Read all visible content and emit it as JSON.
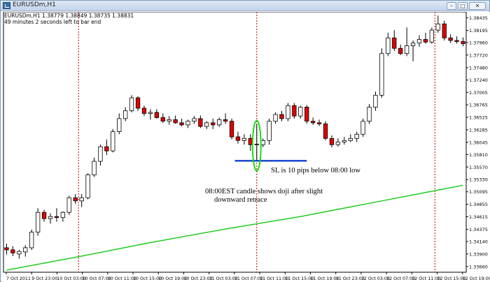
{
  "window": {
    "title": "EURUSDm,H1",
    "buttons": {
      "minimize": "–",
      "maximize": "□",
      "close": "✕"
    }
  },
  "chart_info": {
    "line1": "EURUSDm,H1  1.38779 1.38849 1.38735 1.38831",
    "line2": "49 minutes 2 seconds left to bar end"
  },
  "annotations": {
    "sl_text": "SL is 10 pips below 08:00 low",
    "doji_line1": "08:00EST candle shows doji after slight",
    "doji_line2": "downward retrace"
  },
  "colors": {
    "bull_body": "#ffffff",
    "bear_body": "#e00000",
    "candle_outline": "#000000",
    "ma_line": "#22cc22",
    "session_line": "#c00000",
    "sl_line": "#0033cc",
    "ellipse": "#00dd00"
  },
  "chart_data": {
    "type": "candlestick",
    "symbol": "EURUSDm",
    "timeframe": "H1",
    "ylim": [
      1.3355,
      1.3855
    ],
    "y_ticks": [
      "1.38435",
      "1.38195",
      "1.37960",
      "1.37720",
      "1.37480",
      "1.37240",
      "1.37005",
      "1.36765",
      "1.36525",
      "1.36285",
      "1.36045",
      "1.35810",
      "1.35570",
      "1.35330",
      "1.35095",
      "1.34855",
      "1.34615",
      "1.34375",
      "1.34140",
      "1.33900",
      "1.33660"
    ],
    "x_ticks": [
      "7 Oct 2011",
      "9 Oct 23:00",
      "10 Oct 03:00",
      "10 Oct 07:00",
      "10 Oct 11:00",
      "10 Oct 15:00",
      "10 Oct 19:00",
      "10 Oct 23:03",
      "11 Oct 03:00",
      "11 Oct 07:00",
      "11 Oct 11:00",
      "11 Oct 15:00",
      "11 Oct 19:00",
      "11 Oct 23:03",
      "12 Oct 03:00",
      "12 Oct 07:00",
      "12 Oct 11:00",
      "12 Oct 15:00",
      "12 Oct 19:00"
    ],
    "candles": [
      {
        "o": 1.3402,
        "h": 1.341,
        "l": 1.3389,
        "c": 1.3398
      },
      {
        "o": 1.3398,
        "h": 1.3405,
        "l": 1.3386,
        "c": 1.3392
      },
      {
        "o": 1.339,
        "h": 1.3398,
        "l": 1.3381,
        "c": 1.3395
      },
      {
        "o": 1.3394,
        "h": 1.3407,
        "l": 1.3385,
        "c": 1.3402
      },
      {
        "o": 1.3402,
        "h": 1.3437,
        "l": 1.3398,
        "c": 1.3432
      },
      {
        "o": 1.3432,
        "h": 1.3478,
        "l": 1.3425,
        "c": 1.347
      },
      {
        "o": 1.347,
        "h": 1.3475,
        "l": 1.3452,
        "c": 1.3458
      },
      {
        "o": 1.3458,
        "h": 1.3468,
        "l": 1.3448,
        "c": 1.3462
      },
      {
        "o": 1.3462,
        "h": 1.3478,
        "l": 1.3452,
        "c": 1.346
      },
      {
        "o": 1.346,
        "h": 1.3472,
        "l": 1.3452,
        "c": 1.347
      },
      {
        "o": 1.347,
        "h": 1.3502,
        "l": 1.3465,
        "c": 1.3498
      },
      {
        "o": 1.3498,
        "h": 1.3505,
        "l": 1.3486,
        "c": 1.3492
      },
      {
        "o": 1.3492,
        "h": 1.3505,
        "l": 1.348,
        "c": 1.3498
      },
      {
        "o": 1.3498,
        "h": 1.3545,
        "l": 1.3495,
        "c": 1.3542
      },
      {
        "o": 1.3542,
        "h": 1.3575,
        "l": 1.3538,
        "c": 1.3568
      },
      {
        "o": 1.3568,
        "h": 1.36,
        "l": 1.356,
        "c": 1.3596
      },
      {
        "o": 1.3596,
        "h": 1.361,
        "l": 1.358,
        "c": 1.3588
      },
      {
        "o": 1.3588,
        "h": 1.363,
        "l": 1.3585,
        "c": 1.3625
      },
      {
        "o": 1.3625,
        "h": 1.366,
        "l": 1.362,
        "c": 1.365
      },
      {
        "o": 1.365,
        "h": 1.3672,
        "l": 1.3645,
        "c": 1.3665
      },
      {
        "o": 1.3665,
        "h": 1.3695,
        "l": 1.3662,
        "c": 1.369
      },
      {
        "o": 1.369,
        "h": 1.3693,
        "l": 1.3665,
        "c": 1.367
      },
      {
        "o": 1.367,
        "h": 1.3675,
        "l": 1.3655,
        "c": 1.366
      },
      {
        "o": 1.366,
        "h": 1.3668,
        "l": 1.3648,
        "c": 1.3662
      },
      {
        "o": 1.3662,
        "h": 1.3668,
        "l": 1.365,
        "c": 1.3652
      },
      {
        "o": 1.3652,
        "h": 1.366,
        "l": 1.3642,
        "c": 1.3645
      },
      {
        "o": 1.3645,
        "h": 1.3655,
        "l": 1.3638,
        "c": 1.3648
      },
      {
        "o": 1.3648,
        "h": 1.3656,
        "l": 1.364,
        "c": 1.3642
      },
      {
        "o": 1.3642,
        "h": 1.365,
        "l": 1.3635,
        "c": 1.3638
      },
      {
        "o": 1.3638,
        "h": 1.3648,
        "l": 1.3632,
        "c": 1.3645
      },
      {
        "o": 1.3645,
        "h": 1.3655,
        "l": 1.364,
        "c": 1.365
      },
      {
        "o": 1.365,
        "h": 1.3656,
        "l": 1.3632,
        "c": 1.3635
      },
      {
        "o": 1.3635,
        "h": 1.3645,
        "l": 1.363,
        "c": 1.3642
      },
      {
        "o": 1.3642,
        "h": 1.365,
        "l": 1.363,
        "c": 1.3638
      },
      {
        "o": 1.3638,
        "h": 1.3652,
        "l": 1.3634,
        "c": 1.3648
      },
      {
        "o": 1.3648,
        "h": 1.366,
        "l": 1.364,
        "c": 1.3645
      },
      {
        "o": 1.3645,
        "h": 1.365,
        "l": 1.361,
        "c": 1.3615
      },
      {
        "o": 1.3615,
        "h": 1.3625,
        "l": 1.3602,
        "c": 1.3608
      },
      {
        "o": 1.3608,
        "h": 1.362,
        "l": 1.36,
        "c": 1.3612
      },
      {
        "o": 1.3612,
        "h": 1.362,
        "l": 1.3588,
        "c": 1.36
      },
      {
        "o": 1.36,
        "h": 1.364,
        "l": 1.357,
        "c": 1.3601
      },
      {
        "o": 1.36,
        "h": 1.3612,
        "l": 1.3595,
        "c": 1.3608
      },
      {
        "o": 1.3608,
        "h": 1.365,
        "l": 1.36,
        "c": 1.3645
      },
      {
        "o": 1.3645,
        "h": 1.3662,
        "l": 1.364,
        "c": 1.3658
      },
      {
        "o": 1.3658,
        "h": 1.3665,
        "l": 1.3645,
        "c": 1.365
      },
      {
        "o": 1.365,
        "h": 1.368,
        "l": 1.3645,
        "c": 1.3675
      },
      {
        "o": 1.3675,
        "h": 1.368,
        "l": 1.365,
        "c": 1.3655
      },
      {
        "o": 1.3655,
        "h": 1.3675,
        "l": 1.365,
        "c": 1.3672
      },
      {
        "o": 1.3672,
        "h": 1.3676,
        "l": 1.364,
        "c": 1.3645
      },
      {
        "o": 1.3645,
        "h": 1.3652,
        "l": 1.3638,
        "c": 1.3642
      },
      {
        "o": 1.3642,
        "h": 1.3648,
        "l": 1.3636,
        "c": 1.364
      },
      {
        "o": 1.364,
        "h": 1.3645,
        "l": 1.3608,
        "c": 1.3612
      },
      {
        "o": 1.3612,
        "h": 1.3618,
        "l": 1.3595,
        "c": 1.36
      },
      {
        "o": 1.36,
        "h": 1.3612,
        "l": 1.3596,
        "c": 1.3605
      },
      {
        "o": 1.3605,
        "h": 1.3615,
        "l": 1.36,
        "c": 1.3608
      },
      {
        "o": 1.3608,
        "h": 1.362,
        "l": 1.3605,
        "c": 1.3612
      },
      {
        "o": 1.3612,
        "h": 1.3625,
        "l": 1.3605,
        "c": 1.362
      },
      {
        "o": 1.362,
        "h": 1.365,
        "l": 1.3615,
        "c": 1.3645
      },
      {
        "o": 1.3645,
        "h": 1.3678,
        "l": 1.364,
        "c": 1.3672
      },
      {
        "o": 1.3672,
        "h": 1.3702,
        "l": 1.3665,
        "c": 1.3695
      },
      {
        "o": 1.3695,
        "h": 1.3785,
        "l": 1.369,
        "c": 1.3775
      },
      {
        "o": 1.3775,
        "h": 1.3815,
        "l": 1.377,
        "c": 1.3805
      },
      {
        "o": 1.3805,
        "h": 1.382,
        "l": 1.378,
        "c": 1.3785
      },
      {
        "o": 1.3785,
        "h": 1.3792,
        "l": 1.3772,
        "c": 1.3775
      },
      {
        "o": 1.3775,
        "h": 1.3825,
        "l": 1.377,
        "c": 1.379
      },
      {
        "o": 1.379,
        "h": 1.38,
        "l": 1.376,
        "c": 1.3795
      },
      {
        "o": 1.3795,
        "h": 1.381,
        "l": 1.3788,
        "c": 1.3802
      },
      {
        "o": 1.3802,
        "h": 1.3815,
        "l": 1.3794,
        "c": 1.3797
      },
      {
        "o": 1.3797,
        "h": 1.3825,
        "l": 1.3794,
        "c": 1.382
      },
      {
        "o": 1.382,
        "h": 1.3848,
        "l": 1.3815,
        "c": 1.3832
      },
      {
        "o": 1.3832,
        "h": 1.3838,
        "l": 1.38,
        "c": 1.3805
      },
      {
        "o": 1.3805,
        "h": 1.3812,
        "l": 1.3795,
        "c": 1.38
      },
      {
        "o": 1.38,
        "h": 1.3808,
        "l": 1.3794,
        "c": 1.3798
      },
      {
        "o": 1.3798,
        "h": 1.3806,
        "l": 1.3789,
        "c": 1.3794
      }
    ],
    "moving_average": [
      [
        0,
        1.3359
      ],
      [
        12,
        1.3386
      ],
      [
        23,
        1.3412
      ],
      [
        35,
        1.3438
      ],
      [
        47,
        1.3462
      ],
      [
        60,
        1.3492
      ],
      [
        73,
        1.3522
      ]
    ],
    "sl_level": 1.3569
  }
}
